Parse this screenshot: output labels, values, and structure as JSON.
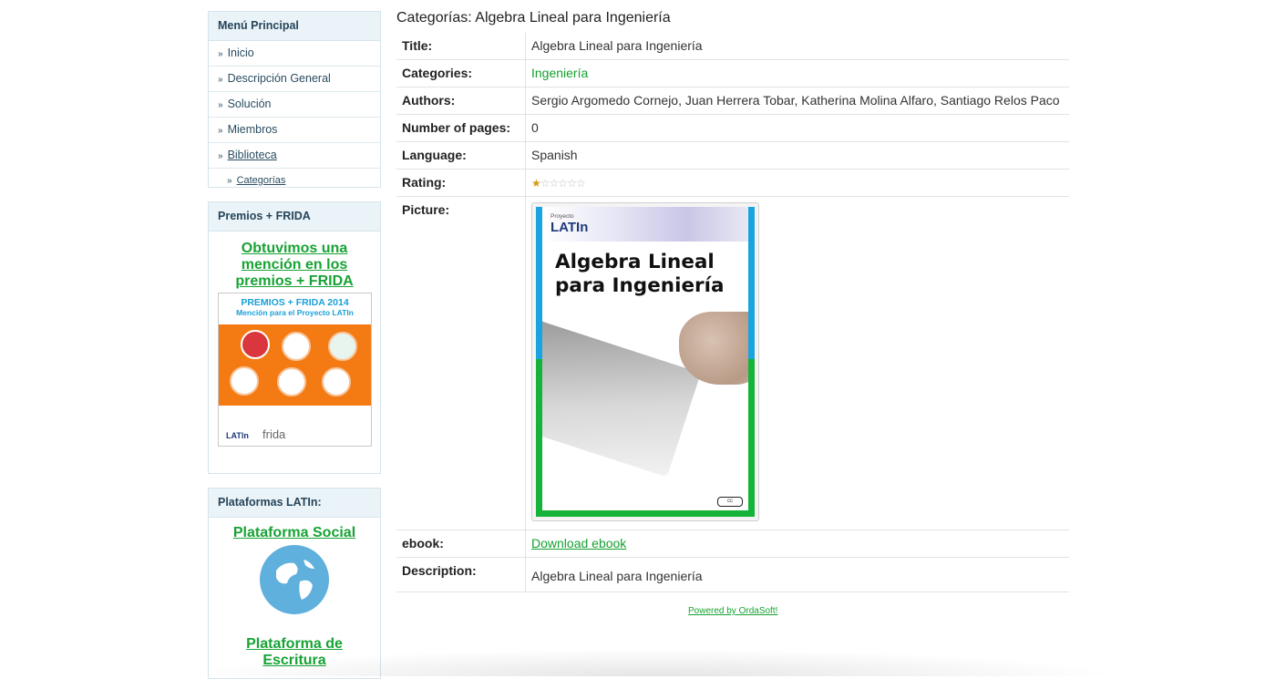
{
  "sidebar": {
    "menu": {
      "heading": "Menú Principal",
      "items": [
        {
          "label": "Inicio"
        },
        {
          "label": "Descripción General"
        },
        {
          "label": "Solución"
        },
        {
          "label": "Miembros"
        },
        {
          "label": "Biblioteca"
        },
        {
          "label": "Categorías"
        }
      ]
    },
    "premios": {
      "heading": "Premios + FRIDA",
      "link_text": "Obtuvimos una mención en los premios + FRIDA",
      "image": {
        "line1": "PREMIOS + FRIDA 2014",
        "line2": "Mención para el Proyecto LATIn",
        "logo1": "LATIn",
        "logo2": "frida"
      }
    },
    "plataformas": {
      "heading": "Plataformas LATIn:",
      "social_link": "Plataforma Social",
      "writing_link": "Plataforma de Escritura"
    }
  },
  "main": {
    "title": "Categorías: Algebra Lineal para Ingeniería",
    "rows": {
      "title_label": "Title:",
      "title_value": "Algebra Lineal para Ingeniería",
      "categories_label": "Categories:",
      "categories_value": "Ingeniería",
      "authors_label": "Authors:",
      "authors_value": "Sergio Argomedo Cornejo, Juan Herrera Tobar, Katherina Molina Alfaro, Santiago Relos Paco",
      "pages_label": "Number of pages:",
      "pages_value": "0",
      "language_label": "Language:",
      "language_value": "Spanish",
      "rating_label": "Rating:",
      "rating_value": 1,
      "rating_max": 6,
      "picture_label": "Picture:",
      "ebook_label": "ebook:",
      "ebook_link": "Download ebook",
      "description_label": "Description:",
      "description_value": "Algebra Lineal para Ingeniería"
    },
    "cover": {
      "logo": "LATIn",
      "logo_small": "Proyecto",
      "title_line1": "Algebra Lineal",
      "title_line2": "para Ingeniería"
    },
    "footer_link": "Powered by OrdaSoft!"
  },
  "colors": {
    "link_green": "#17a334",
    "module_header_bg": "#eaf3f7",
    "rating_star": "#d49a12",
    "frida_orange": "#f47b14",
    "cover_blue": "#1aa4df",
    "cover_green": "#16b33a"
  }
}
